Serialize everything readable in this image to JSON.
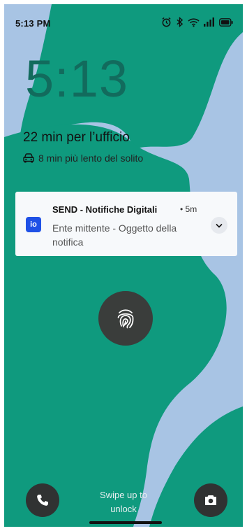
{
  "status_bar": {
    "time": "5:13 PM",
    "icons": [
      "alarm-icon",
      "bluetooth-icon",
      "wifi-icon",
      "signal-icon",
      "battery-icon"
    ]
  },
  "lock_screen": {
    "clock": "5:13",
    "commute_title": "22 min per l’ufficio",
    "commute_detail": "8 min più lento del solito",
    "commute_icon": "car-icon"
  },
  "notification": {
    "app_name": "SEND - Notifiche Digitali",
    "time": "• 5m",
    "app_icon_text": "io",
    "body": "Ente mittente - Oggetto della notifica"
  },
  "bottom": {
    "swipe_hint": "Swipe up to unlock"
  },
  "colors": {
    "wallpaper_blue": "#a8c4e4",
    "wallpaper_green": "#0f9a7e",
    "clock": "#126b5d",
    "app_icon": "#1f51e6",
    "button_dark": "#303232"
  }
}
